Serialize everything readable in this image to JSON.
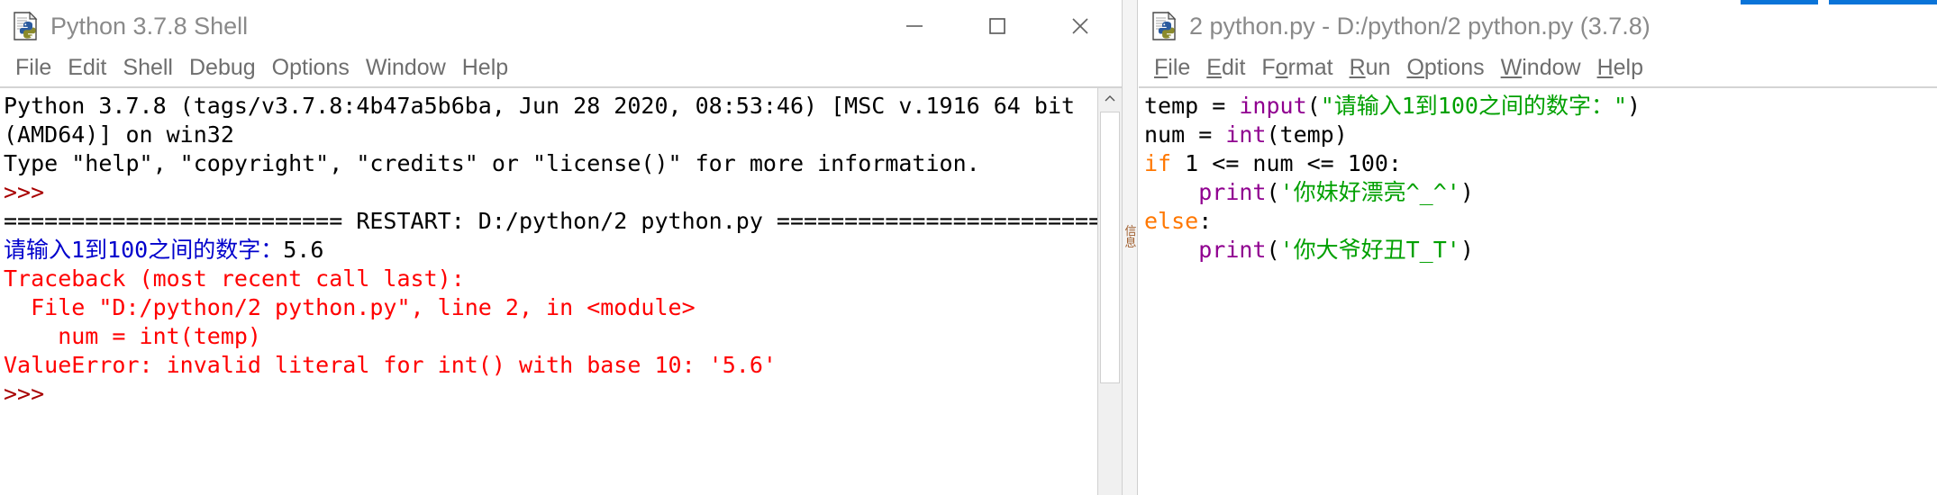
{
  "shell_window": {
    "title": "Python 3.7.8 Shell",
    "icon": "python-file-icon",
    "window_controls": {
      "minimize": "minimize-icon",
      "maximize": "maximize-icon",
      "close": "close-icon"
    },
    "menus": [
      "File",
      "Edit",
      "Shell",
      "Debug",
      "Options",
      "Window",
      "Help"
    ],
    "output_lines": [
      {
        "segments": [
          {
            "text": "Python 3.7.8 (tags/v3.7.8:4b47a5b6ba, Jun 28 2020, 08:53:46) [MSC v.1916 64 bit",
            "color": "black"
          }
        ]
      },
      {
        "segments": [
          {
            "text": "(AMD64)] on win32",
            "color": "black"
          }
        ]
      },
      {
        "segments": [
          {
            "text": "Type \"help\", \"copyright\", \"credits\" or \"license()\" for more information.",
            "color": "black"
          }
        ]
      },
      {
        "segments": [
          {
            "text": ">>> ",
            "color": "darkred"
          }
        ]
      },
      {
        "segments": [
          {
            "text": "========================= RESTART: D:/python/2 python.py =========================",
            "color": "black"
          }
        ]
      },
      {
        "segments": [
          {
            "text": "请输入1到100之间的数字：",
            "color": "blue"
          },
          {
            "text": "5.6",
            "color": "black"
          }
        ]
      },
      {
        "segments": [
          {
            "text": "Traceback (most recent call last):",
            "color": "red"
          }
        ]
      },
      {
        "segments": [
          {
            "text": "  File \"D:/python/2 python.py\", line 2, in <module>",
            "color": "red"
          }
        ]
      },
      {
        "segments": [
          {
            "text": "    num = int(temp)",
            "color": "red"
          }
        ]
      },
      {
        "segments": [
          {
            "text": "ValueError: invalid literal for int() with base 10: '5.6'",
            "color": "red"
          }
        ]
      },
      {
        "segments": [
          {
            "text": ">>> ",
            "color": "darkred"
          }
        ]
      }
    ],
    "scrollbar": {
      "up_arrow": "chevron-up-icon"
    }
  },
  "editor_window": {
    "title": "2 python.py - D:/python/2 python.py (3.7.8)",
    "icon": "python-file-icon",
    "menus": [
      {
        "label": "File",
        "mnemonic": "F"
      },
      {
        "label": "Edit",
        "mnemonic": "E"
      },
      {
        "label": "Format",
        "mnemonic": "o"
      },
      {
        "label": "Run",
        "mnemonic": "R"
      },
      {
        "label": "Options",
        "mnemonic": "O"
      },
      {
        "label": "Window",
        "mnemonic": "W"
      },
      {
        "label": "Help",
        "mnemonic": "H"
      }
    ],
    "code_lines": [
      {
        "tokens": [
          {
            "text": "temp = ",
            "kind": "default"
          },
          {
            "text": "input",
            "kind": "builtin"
          },
          {
            "text": "(",
            "kind": "default"
          },
          {
            "text": "\"请输入1到100之间的数字：\"",
            "kind": "string"
          },
          {
            "text": ")",
            "kind": "default"
          }
        ]
      },
      {
        "tokens": [
          {
            "text": "num = ",
            "kind": "default"
          },
          {
            "text": "int",
            "kind": "builtin"
          },
          {
            "text": "(temp)",
            "kind": "default"
          }
        ]
      },
      {
        "tokens": [
          {
            "text": "if",
            "kind": "keyword"
          },
          {
            "text": " 1 <= num <= 100:",
            "kind": "default"
          }
        ]
      },
      {
        "tokens": [
          {
            "text": "    ",
            "kind": "default"
          },
          {
            "text": "print",
            "kind": "builtin"
          },
          {
            "text": "(",
            "kind": "default"
          },
          {
            "text": "'你妹好漂亮^_^'",
            "kind": "string"
          },
          {
            "text": ")",
            "kind": "default"
          }
        ]
      },
      {
        "tokens": [
          {
            "text": "else",
            "kind": "keyword"
          },
          {
            "text": ":",
            "kind": "default"
          }
        ]
      },
      {
        "tokens": [
          {
            "text": "    ",
            "kind": "default"
          },
          {
            "text": "print",
            "kind": "builtin"
          },
          {
            "text": "(",
            "kind": "default"
          },
          {
            "text": "'你大爷好丑T_T'",
            "kind": "string"
          },
          {
            "text": ")",
            "kind": "default"
          }
        ]
      }
    ]
  },
  "gap_strip": {
    "vertical_label": "信息"
  },
  "colors": {
    "title_text": "#8a8a8a",
    "menu_text": "#6e6e6e",
    "shell_error": "#ff0000",
    "shell_prompt": "#a80000",
    "shell_input_prompt": "#0000cc",
    "code_keyword": "#ff7700",
    "code_builtin": "#900090",
    "code_string": "#00a000",
    "accent": "#0a74d8"
  }
}
